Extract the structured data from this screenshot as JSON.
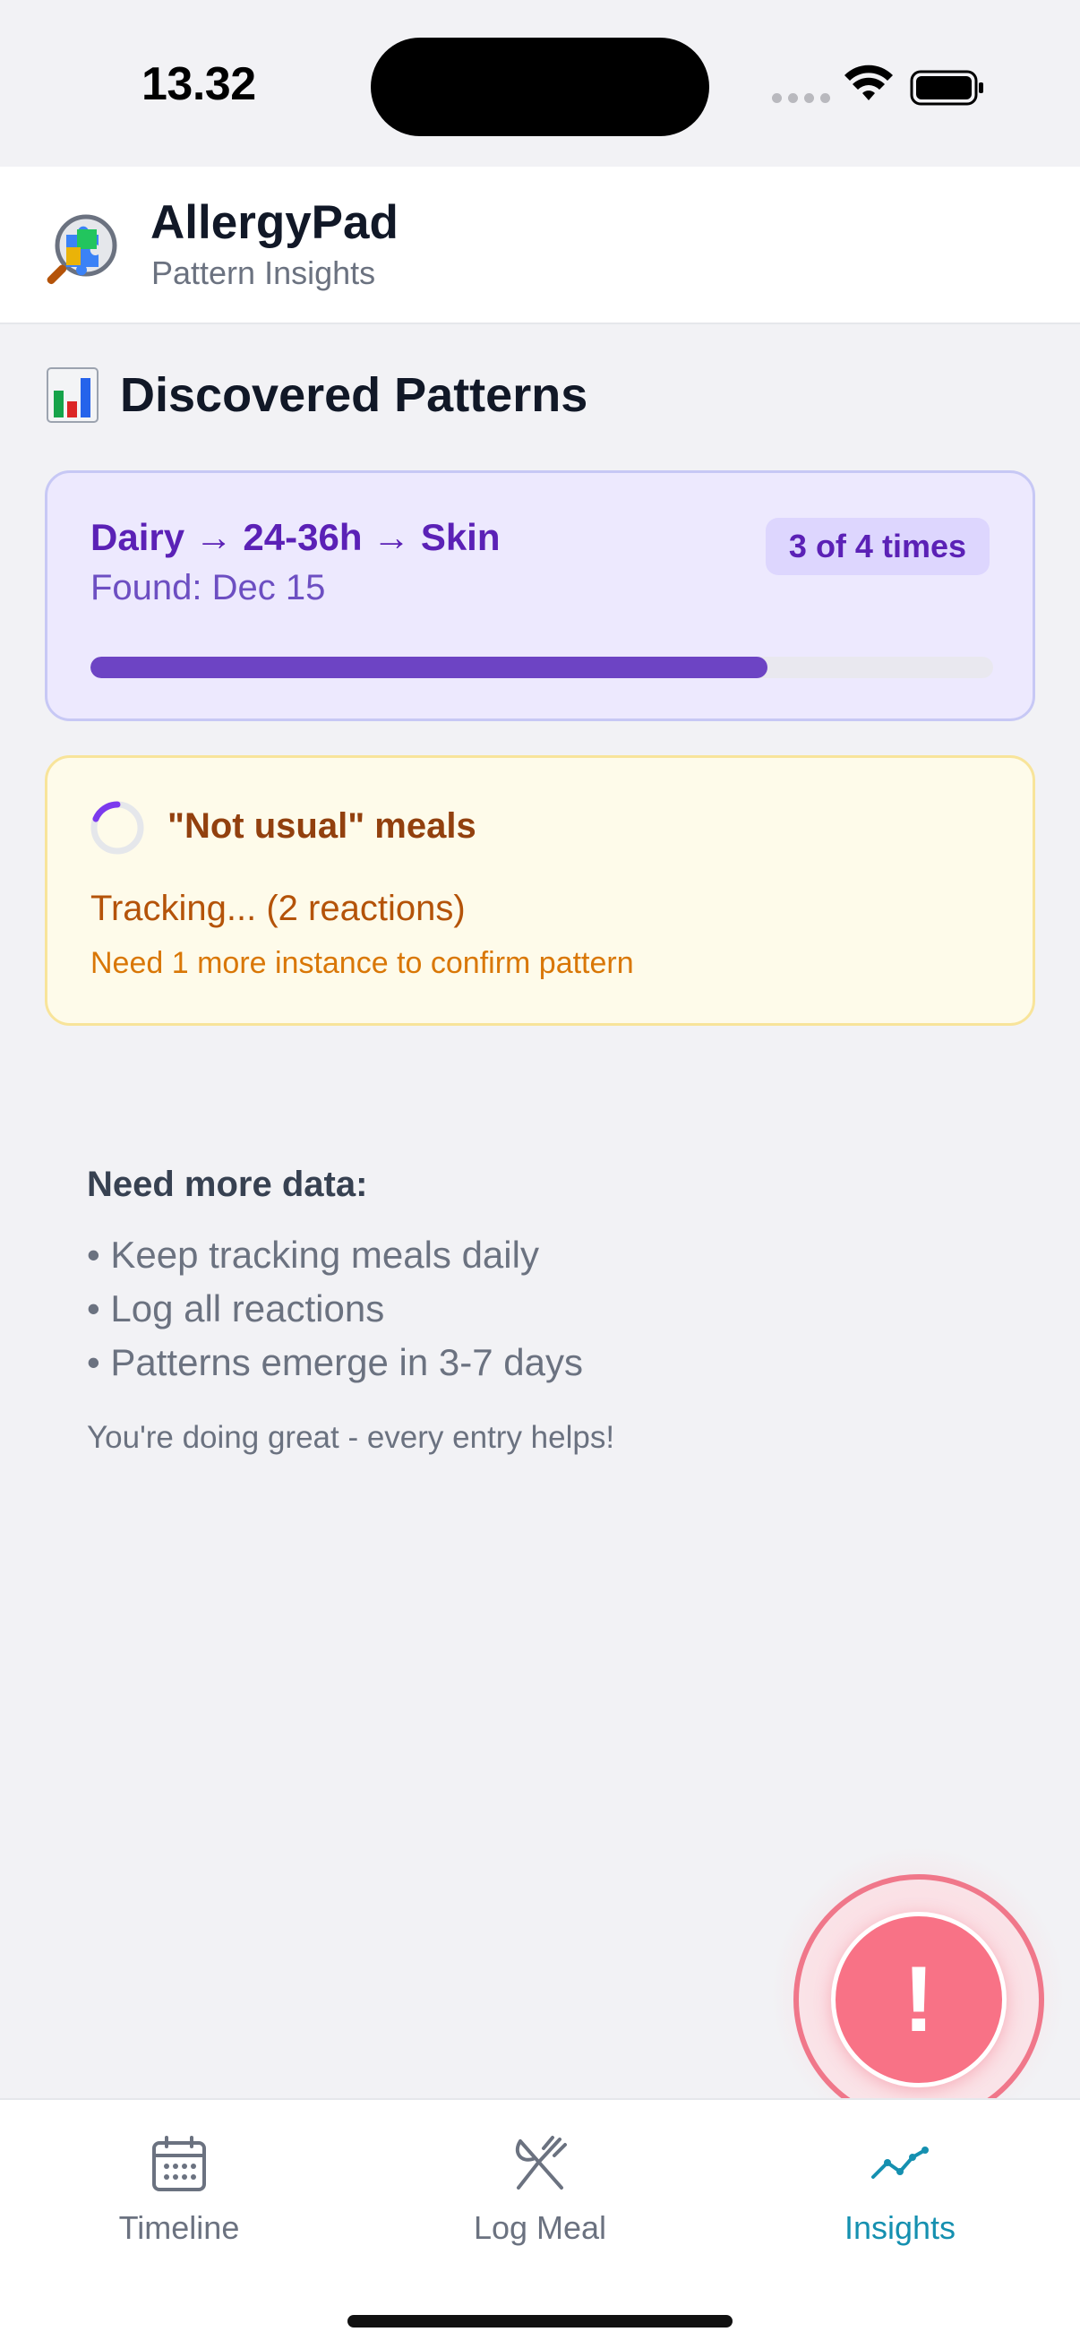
{
  "status_bar": {
    "time": "13.32"
  },
  "header": {
    "title": "AllergyPad",
    "subtitle": "Pattern Insights",
    "logo_icon": "magnifier-puzzle-icon"
  },
  "section": {
    "title": "Discovered Patterns",
    "icon": "bar-chart-icon"
  },
  "pattern": {
    "title": "Dairy → 24-36h → Skin",
    "found": "Found: Dec 15",
    "badge": "3 of 4 times",
    "progress": 0.75
  },
  "tracking": {
    "title": "\"Not usual\" meals",
    "status": "Tracking... (2 reactions)",
    "note": "Need 1 more instance to confirm pattern",
    "icon": "spinner-icon"
  },
  "tips": {
    "title": "Need more data:",
    "items": [
      "• Keep tracking meals daily",
      "• Log all reactions",
      "• Patterns emerge in 3-7 days"
    ],
    "footer": "You're doing great - every entry helps!"
  },
  "sos": {
    "label": "!"
  },
  "nav": {
    "items": [
      {
        "label": "Timeline",
        "icon": "calendar-icon"
      },
      {
        "label": "Log Meal",
        "icon": "fork-knife-icon"
      },
      {
        "label": "Insights",
        "icon": "trend-line-icon"
      }
    ],
    "active": "Insights"
  },
  "colors": {
    "accent": "#1590b0",
    "pattern_purple": "#5b21b6",
    "progress_fill": "#6d44c4",
    "tracking_brown": "#92400e",
    "sos_red": "#f87286"
  }
}
